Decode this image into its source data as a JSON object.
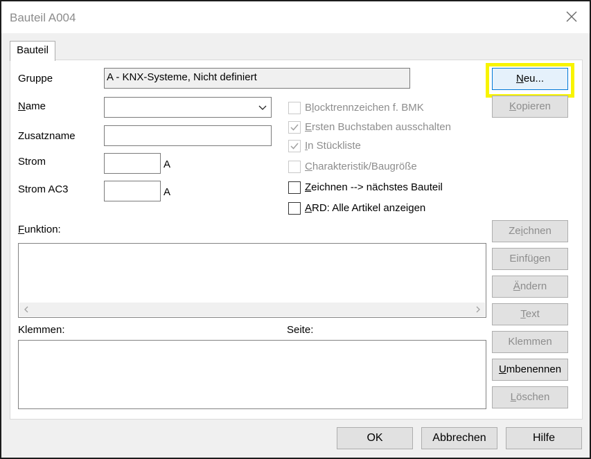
{
  "window": {
    "title": "Bauteil A004"
  },
  "tab": {
    "label": "Bauteil"
  },
  "form": {
    "gruppe_label": "Gruppe",
    "gruppe_value": "A - KNX-Systeme, Nicht definiert",
    "name_label_u": "N",
    "name_label_rest": "ame",
    "name_value": "",
    "zusatzname_label": "Zusatzname",
    "zusatzname_value": "",
    "strom_label": "Strom",
    "strom_value": "",
    "strom_unit": "A",
    "stromac3_label": "Strom AC3",
    "stromac3_value": "",
    "stromac3_unit": "A",
    "funktion_label_u": "F",
    "funktion_label_rest": "unktion:",
    "klemmen_label": "Klemmen:",
    "seite_label": "Seite:"
  },
  "checkboxes": [
    {
      "pre": "B",
      "u": "l",
      "post": "ocktrennzeichen f. BMK",
      "checked": false,
      "enabled": false
    },
    {
      "pre": "",
      "u": "E",
      "post": "rsten Buchstaben ausschalten",
      "checked": true,
      "enabled": false
    },
    {
      "pre": "",
      "u": "I",
      "post": "n Stückliste",
      "checked": true,
      "enabled": false
    },
    {
      "pre": "",
      "u": "C",
      "post": "harakteristik/Baugröße",
      "checked": false,
      "enabled": false
    },
    {
      "pre": "",
      "u": "Z",
      "post": "eichnen --> nächstes Bauteil",
      "checked": false,
      "enabled": true
    },
    {
      "pre": "",
      "u": "A",
      "post": "RD: Alle Artikel anzeigen",
      "checked": false,
      "enabled": true
    }
  ],
  "buttons": {
    "neu": {
      "u": "N",
      "rest": "eu..."
    },
    "kopieren": {
      "u": "K",
      "rest": "opieren"
    },
    "zeichnen": {
      "pre": "Ze",
      "u": "i",
      "rest": "chnen"
    },
    "einfuegen": {
      "label": "Einfügen"
    },
    "aendern": {
      "u": "Ä",
      "rest": "ndern"
    },
    "text": {
      "u": "T",
      "rest": "ext"
    },
    "klemmen": {
      "label": "Klemmen"
    },
    "umbenennen": {
      "u": "U",
      "rest": "mbenennen"
    },
    "loeschen": {
      "u": "L",
      "rest": "öschen"
    }
  },
  "dialog": {
    "ok": "OK",
    "cancel": "Abbrechen",
    "help": "Hilfe"
  },
  "colors": {
    "highlight": "#f8f400",
    "disabled_text": "#8d8d8d"
  }
}
